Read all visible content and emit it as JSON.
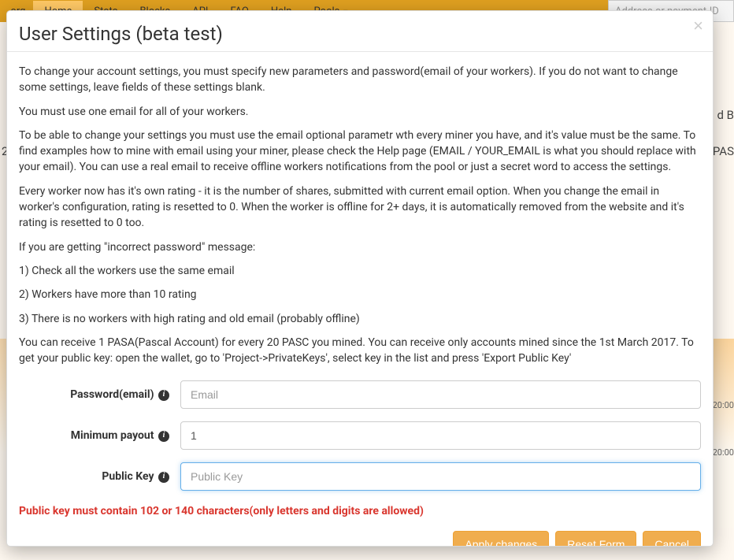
{
  "background": {
    "domain_suffix": ".org",
    "nav": [
      "Home",
      "Stats",
      "Blocks",
      "API",
      "FAQ",
      "Help",
      "Pools"
    ],
    "nav_active_index": 0,
    "search_placeholder": "Address or payment-ID",
    "frag_db": "d B",
    "frag_pas": "PAS",
    "frag_num": "2",
    "frag_time1": "20:00",
    "frag_time2": "20:00"
  },
  "modal": {
    "title": "User Settings (beta test)",
    "paragraphs": [
      "To change your account settings, you must specify new parameters and password(email of your workers). If you do not want to change some settings, leave fields of these settings blank.",
      "You must use one email for all of your workers.",
      "To be able to change your settings you must use the email optional parametr wth every miner you have, and it's value must be the same. To find examples how to mine with email using your miner, please check the Help page (EMAIL / YOUR_EMAIL is what you should replace with your email). You can use a real email to receive offline workers notifications from the pool or just a secret word to access the settings.",
      "Every worker now has it's own rating - it is the number of shares, submitted with current email option. When you change the email in worker's configuration, rating is resetted to 0. When the worker is offline for 2+ days, it is automatically removed from the website and it's rating is resetted to 0 too.",
      "If you are getting \"incorrect password\" message:",
      "1) Check all the workers use the same email",
      "2) Workers have more than 10 rating",
      "3) There is no workers with high rating and old email (probably offline)",
      "You can receive 1 PASA(Pascal Account) for every 20 PASC you mined. You can receive only accounts mined since the 1st March 2017. To get your public key: open the wallet, go to 'Project->PrivateKeys', select key in the list and press 'Export Public Key'"
    ],
    "form": {
      "password_label": "Password(email)",
      "password_placeholder": "Email",
      "password_value": "",
      "payout_label": "Minimum payout",
      "payout_value": "1",
      "pubkey_label": "Public Key",
      "pubkey_placeholder": "Public Key",
      "pubkey_value": "",
      "error": "Public key must contain 102 or 140 characters(only letters and digits are allowed)",
      "apply_label": "Apply changes",
      "reset_label": "Reset Form",
      "cancel_label": "Cancel"
    }
  }
}
